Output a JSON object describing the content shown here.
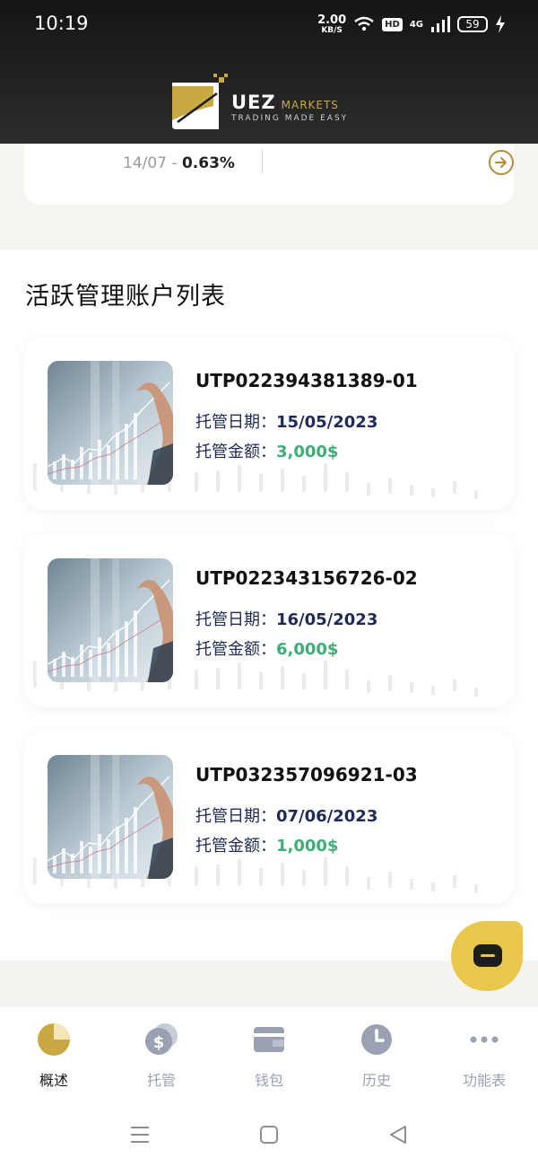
{
  "status_bar": {
    "time": "10:19",
    "speed_value": "2.00",
    "speed_unit": "KB/S",
    "hd": "HD",
    "network": "4G",
    "battery": "59"
  },
  "header": {
    "brand": "UEZ",
    "brand_suffix": "MARKETS",
    "tagline": "TRADING MADE EASY"
  },
  "summary": {
    "date": "14/07",
    "separator": " - ",
    "change": "0.63%"
  },
  "section": {
    "title": "活跃管理账户列表"
  },
  "accounts": [
    {
      "id": "UTP022394381389-01",
      "date_label": "托管日期：",
      "date": "15/05/2023",
      "amount_label": "托管金额：",
      "amount": "3,000$"
    },
    {
      "id": "UTP022343156726-02",
      "date_label": "托管日期：",
      "date": "16/05/2023",
      "amount_label": "托管金额：",
      "amount": "6,000$"
    },
    {
      "id": "UTP032357096921-03",
      "date_label": "托管日期：",
      "date": "07/06/2023",
      "amount_label": "托管金额：",
      "amount": "1,000$"
    }
  ],
  "nav": {
    "items": [
      {
        "label": "概述",
        "icon": "pie-chart-icon",
        "active": true
      },
      {
        "label": "托管",
        "icon": "coins-icon",
        "active": false
      },
      {
        "label": "钱包",
        "icon": "wallet-icon",
        "active": false
      },
      {
        "label": "历史",
        "icon": "clock-icon",
        "active": false
      },
      {
        "label": "功能表",
        "icon": "more-icon",
        "active": false
      }
    ]
  },
  "colors": {
    "gold": "#c9a944",
    "fab": "#ebc64c",
    "amount_green": "#3fae76",
    "label_navy": "#1f2a57",
    "nav_inactive": "#9aa1b3"
  }
}
